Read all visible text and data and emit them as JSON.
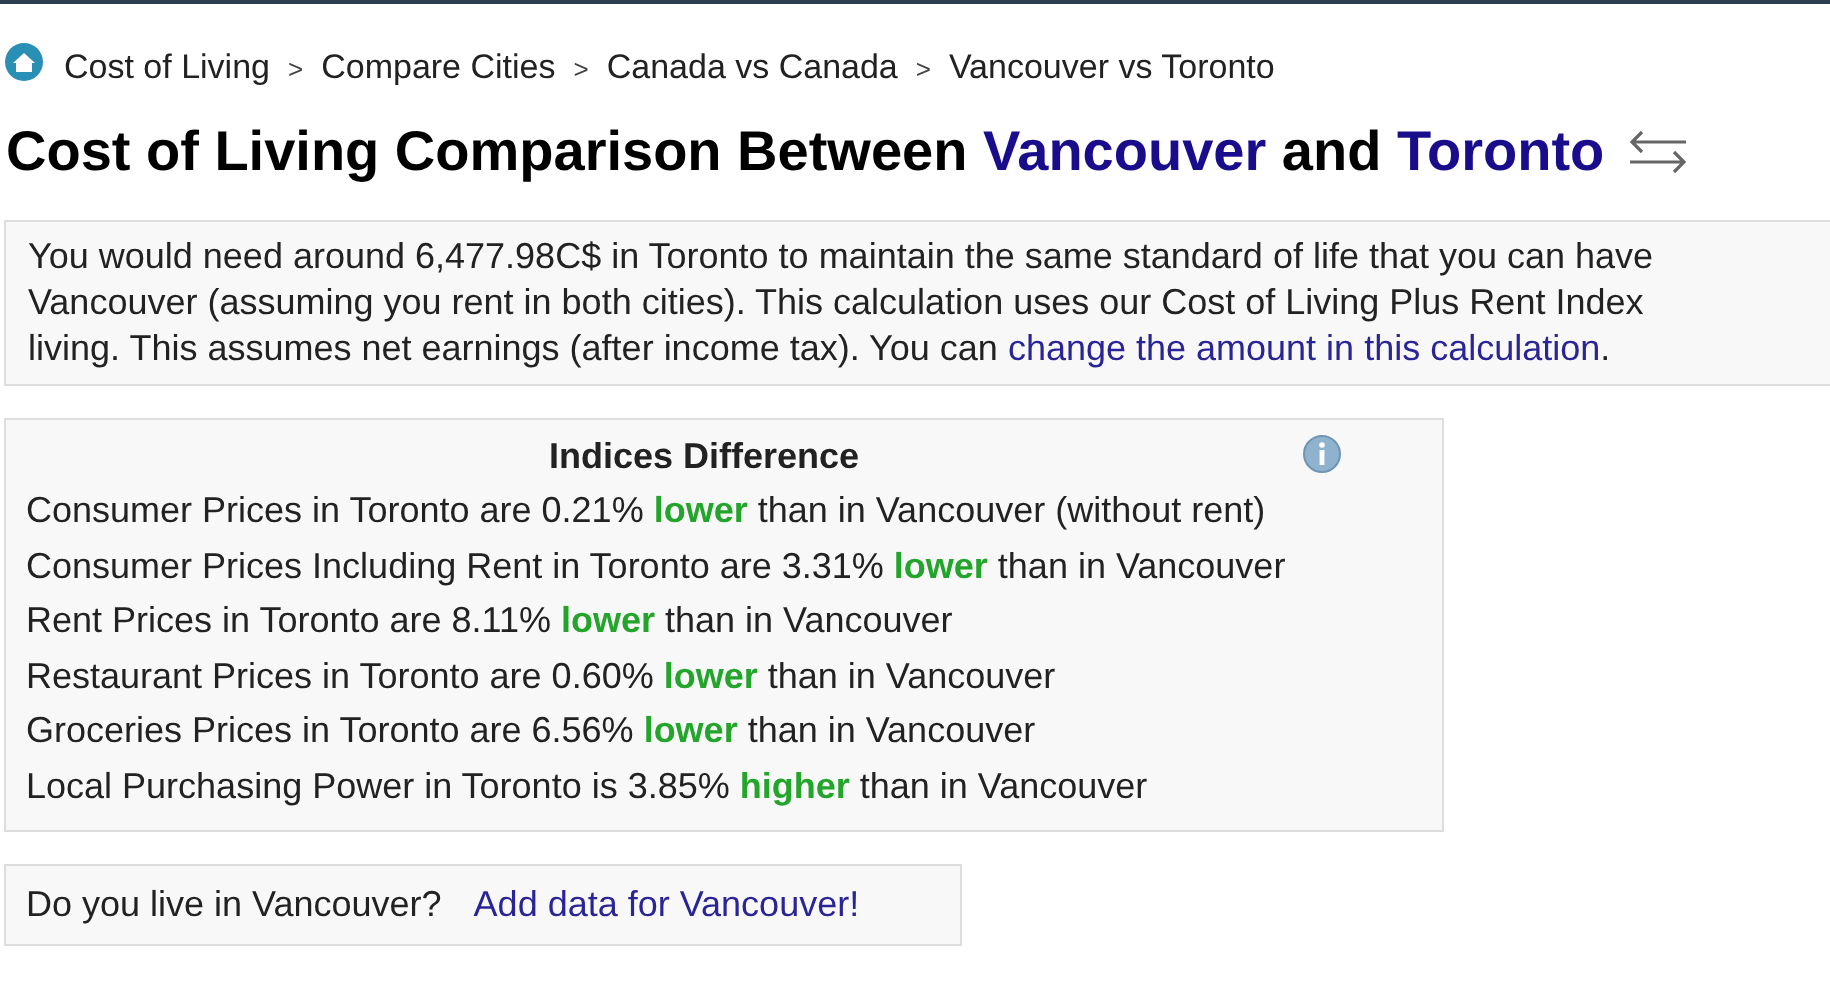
{
  "breadcrumb": [
    {
      "label": "Cost of Living"
    },
    {
      "label": ">"
    },
    {
      "label": "Compare Cities"
    },
    {
      "label": ">"
    },
    {
      "label": "Canada vs Canada"
    },
    {
      "label": ">"
    },
    {
      "label": "Vancouver vs Toronto"
    }
  ],
  "title": [
    {
      "text": "Cost of Living Comparison Between ",
      "kind": "plain"
    },
    {
      "text": "Vancouver",
      "kind": "city"
    },
    {
      "text": " and ",
      "kind": "plain"
    },
    {
      "text": "Toronto",
      "kind": "city"
    }
  ],
  "summary": {
    "lines": [
      "You would need around 6,477.98C$ in Toronto to maintain the same standard of life that you can have",
      "Vancouver (assuming you rent in both cities). This calculation uses our Cost of Living Plus Rent Index",
      "living. This assumes net earnings (after income tax). You can"
    ],
    "link": "change the amount in this calculation",
    "end": "."
  },
  "indices": {
    "title": "Indices Difference",
    "rows": [
      {
        "before": "Consumer Prices in Toronto are 0.21% ",
        "word": "lower",
        "after": " than in Vancouver (without rent)"
      },
      {
        "before": "Consumer Prices Including Rent in Toronto are 3.31% ",
        "word": "lower",
        "after": " than in Vancouver"
      },
      {
        "before": "Rent Prices in Toronto are 8.11% ",
        "word": "lower",
        "after": " than in Vancouver"
      },
      {
        "before": "Restaurant Prices in Toronto are 0.60% ",
        "word": "lower",
        "after": " than in Vancouver"
      },
      {
        "before": "Groceries Prices in Toronto are 6.56% ",
        "word": "lower",
        "after": " than in Vancouver"
      },
      {
        "before": "Local Purchasing Power in Toronto is 3.85% ",
        "word": "higher",
        "after": " than in Vancouver"
      }
    ]
  },
  "live": {
    "question": "Do you live in Vancouver?",
    "link": "Add data for Vancouver!"
  }
}
